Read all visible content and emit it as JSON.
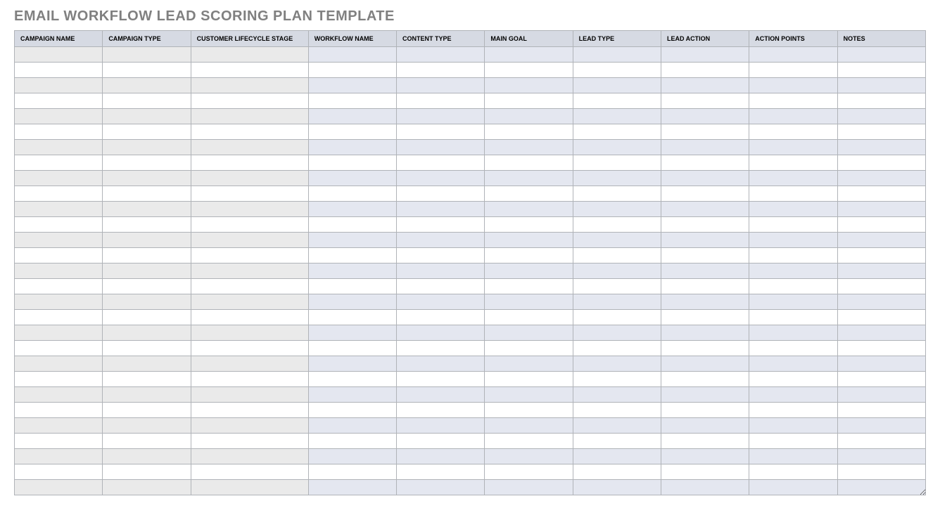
{
  "title": "EMAIL WORKFLOW LEAD SCORING PLAN TEMPLATE",
  "columns": [
    "CAMPAIGN NAME",
    "CAMPAIGN TYPE",
    "CUSTOMER LIFECYCLE STAGE",
    "WORKFLOW NAME",
    "CONTENT TYPE",
    "MAIN GOAL",
    "LEAD TYPE",
    "LEAD ACTION",
    "ACTION POINTS",
    "NOTES"
  ],
  "rows": [
    [
      "",
      "",
      "",
      "",
      "",
      "",
      "",
      "",
      "",
      ""
    ],
    [
      "",
      "",
      "",
      "",
      "",
      "",
      "",
      "",
      "",
      ""
    ],
    [
      "",
      "",
      "",
      "",
      "",
      "",
      "",
      "",
      "",
      ""
    ],
    [
      "",
      "",
      "",
      "",
      "",
      "",
      "",
      "",
      "",
      ""
    ],
    [
      "",
      "",
      "",
      "",
      "",
      "",
      "",
      "",
      "",
      ""
    ],
    [
      "",
      "",
      "",
      "",
      "",
      "",
      "",
      "",
      "",
      ""
    ],
    [
      "",
      "",
      "",
      "",
      "",
      "",
      "",
      "",
      "",
      ""
    ],
    [
      "",
      "",
      "",
      "",
      "",
      "",
      "",
      "",
      "",
      ""
    ],
    [
      "",
      "",
      "",
      "",
      "",
      "",
      "",
      "",
      "",
      ""
    ],
    [
      "",
      "",
      "",
      "",
      "",
      "",
      "",
      "",
      "",
      ""
    ],
    [
      "",
      "",
      "",
      "",
      "",
      "",
      "",
      "",
      "",
      ""
    ],
    [
      "",
      "",
      "",
      "",
      "",
      "",
      "",
      "",
      "",
      ""
    ],
    [
      "",
      "",
      "",
      "",
      "",
      "",
      "",
      "",
      "",
      ""
    ],
    [
      "",
      "",
      "",
      "",
      "",
      "",
      "",
      "",
      "",
      ""
    ],
    [
      "",
      "",
      "",
      "",
      "",
      "",
      "",
      "",
      "",
      ""
    ],
    [
      "",
      "",
      "",
      "",
      "",
      "",
      "",
      "",
      "",
      ""
    ],
    [
      "",
      "",
      "",
      "",
      "",
      "",
      "",
      "",
      "",
      ""
    ],
    [
      "",
      "",
      "",
      "",
      "",
      "",
      "",
      "",
      "",
      ""
    ],
    [
      "",
      "",
      "",
      "",
      "",
      "",
      "",
      "",
      "",
      ""
    ],
    [
      "",
      "",
      "",
      "",
      "",
      "",
      "",
      "",
      "",
      ""
    ],
    [
      "",
      "",
      "",
      "",
      "",
      "",
      "",
      "",
      "",
      ""
    ],
    [
      "",
      "",
      "",
      "",
      "",
      "",
      "",
      "",
      "",
      ""
    ],
    [
      "",
      "",
      "",
      "",
      "",
      "",
      "",
      "",
      "",
      ""
    ],
    [
      "",
      "",
      "",
      "",
      "",
      "",
      "",
      "",
      "",
      ""
    ],
    [
      "",
      "",
      "",
      "",
      "",
      "",
      "",
      "",
      "",
      ""
    ],
    [
      "",
      "",
      "",
      "",
      "",
      "",
      "",
      "",
      "",
      ""
    ],
    [
      "",
      "",
      "",
      "",
      "",
      "",
      "",
      "",
      "",
      ""
    ],
    [
      "",
      "",
      "",
      "",
      "",
      "",
      "",
      "",
      "",
      ""
    ],
    [
      "",
      "",
      "",
      "",
      "",
      "",
      "",
      "",
      "",
      ""
    ]
  ]
}
